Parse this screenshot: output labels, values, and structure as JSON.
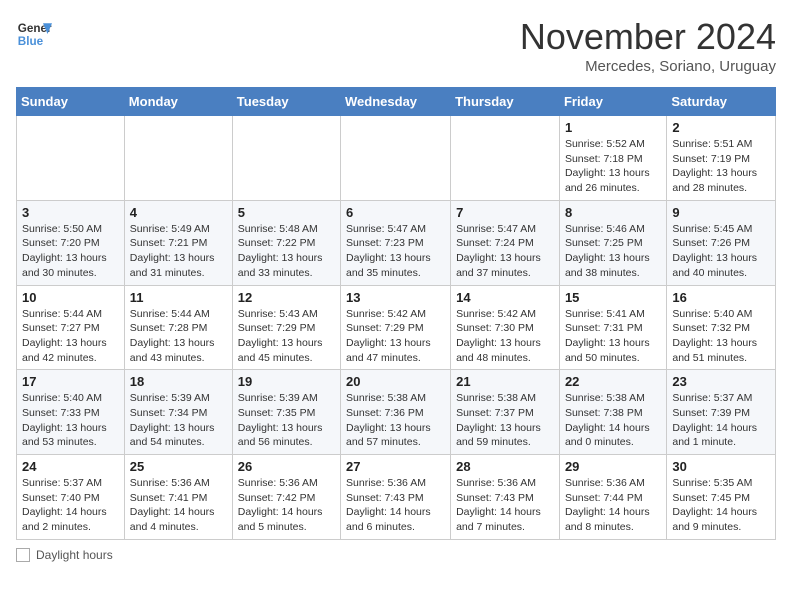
{
  "logo": {
    "line1": "General",
    "line2": "Blue"
  },
  "title": "November 2024",
  "subtitle": "Mercedes, Soriano, Uruguay",
  "days_of_week": [
    "Sunday",
    "Monday",
    "Tuesday",
    "Wednesday",
    "Thursday",
    "Friday",
    "Saturday"
  ],
  "legend_label": "Daylight hours",
  "weeks": [
    [
      {
        "day": "",
        "info": ""
      },
      {
        "day": "",
        "info": ""
      },
      {
        "day": "",
        "info": ""
      },
      {
        "day": "",
        "info": ""
      },
      {
        "day": "",
        "info": ""
      },
      {
        "day": "1",
        "info": "Sunrise: 5:52 AM\nSunset: 7:18 PM\nDaylight: 13 hours\nand 26 minutes."
      },
      {
        "day": "2",
        "info": "Sunrise: 5:51 AM\nSunset: 7:19 PM\nDaylight: 13 hours\nand 28 minutes."
      }
    ],
    [
      {
        "day": "3",
        "info": "Sunrise: 5:50 AM\nSunset: 7:20 PM\nDaylight: 13 hours\nand 30 minutes."
      },
      {
        "day": "4",
        "info": "Sunrise: 5:49 AM\nSunset: 7:21 PM\nDaylight: 13 hours\nand 31 minutes."
      },
      {
        "day": "5",
        "info": "Sunrise: 5:48 AM\nSunset: 7:22 PM\nDaylight: 13 hours\nand 33 minutes."
      },
      {
        "day": "6",
        "info": "Sunrise: 5:47 AM\nSunset: 7:23 PM\nDaylight: 13 hours\nand 35 minutes."
      },
      {
        "day": "7",
        "info": "Sunrise: 5:47 AM\nSunset: 7:24 PM\nDaylight: 13 hours\nand 37 minutes."
      },
      {
        "day": "8",
        "info": "Sunrise: 5:46 AM\nSunset: 7:25 PM\nDaylight: 13 hours\nand 38 minutes."
      },
      {
        "day": "9",
        "info": "Sunrise: 5:45 AM\nSunset: 7:26 PM\nDaylight: 13 hours\nand 40 minutes."
      }
    ],
    [
      {
        "day": "10",
        "info": "Sunrise: 5:44 AM\nSunset: 7:27 PM\nDaylight: 13 hours\nand 42 minutes."
      },
      {
        "day": "11",
        "info": "Sunrise: 5:44 AM\nSunset: 7:28 PM\nDaylight: 13 hours\nand 43 minutes."
      },
      {
        "day": "12",
        "info": "Sunrise: 5:43 AM\nSunset: 7:29 PM\nDaylight: 13 hours\nand 45 minutes."
      },
      {
        "day": "13",
        "info": "Sunrise: 5:42 AM\nSunset: 7:29 PM\nDaylight: 13 hours\nand 47 minutes."
      },
      {
        "day": "14",
        "info": "Sunrise: 5:42 AM\nSunset: 7:30 PM\nDaylight: 13 hours\nand 48 minutes."
      },
      {
        "day": "15",
        "info": "Sunrise: 5:41 AM\nSunset: 7:31 PM\nDaylight: 13 hours\nand 50 minutes."
      },
      {
        "day": "16",
        "info": "Sunrise: 5:40 AM\nSunset: 7:32 PM\nDaylight: 13 hours\nand 51 minutes."
      }
    ],
    [
      {
        "day": "17",
        "info": "Sunrise: 5:40 AM\nSunset: 7:33 PM\nDaylight: 13 hours\nand 53 minutes."
      },
      {
        "day": "18",
        "info": "Sunrise: 5:39 AM\nSunset: 7:34 PM\nDaylight: 13 hours\nand 54 minutes."
      },
      {
        "day": "19",
        "info": "Sunrise: 5:39 AM\nSunset: 7:35 PM\nDaylight: 13 hours\nand 56 minutes."
      },
      {
        "day": "20",
        "info": "Sunrise: 5:38 AM\nSunset: 7:36 PM\nDaylight: 13 hours\nand 57 minutes."
      },
      {
        "day": "21",
        "info": "Sunrise: 5:38 AM\nSunset: 7:37 PM\nDaylight: 13 hours\nand 59 minutes."
      },
      {
        "day": "22",
        "info": "Sunrise: 5:38 AM\nSunset: 7:38 PM\nDaylight: 14 hours\nand 0 minutes."
      },
      {
        "day": "23",
        "info": "Sunrise: 5:37 AM\nSunset: 7:39 PM\nDaylight: 14 hours\nand 1 minute."
      }
    ],
    [
      {
        "day": "24",
        "info": "Sunrise: 5:37 AM\nSunset: 7:40 PM\nDaylight: 14 hours\nand 2 minutes."
      },
      {
        "day": "25",
        "info": "Sunrise: 5:36 AM\nSunset: 7:41 PM\nDaylight: 14 hours\nand 4 minutes."
      },
      {
        "day": "26",
        "info": "Sunrise: 5:36 AM\nSunset: 7:42 PM\nDaylight: 14 hours\nand 5 minutes."
      },
      {
        "day": "27",
        "info": "Sunrise: 5:36 AM\nSunset: 7:43 PM\nDaylight: 14 hours\nand 6 minutes."
      },
      {
        "day": "28",
        "info": "Sunrise: 5:36 AM\nSunset: 7:43 PM\nDaylight: 14 hours\nand 7 minutes."
      },
      {
        "day": "29",
        "info": "Sunrise: 5:36 AM\nSunset: 7:44 PM\nDaylight: 14 hours\nand 8 minutes."
      },
      {
        "day": "30",
        "info": "Sunrise: 5:35 AM\nSunset: 7:45 PM\nDaylight: 14 hours\nand 9 minutes."
      }
    ]
  ]
}
